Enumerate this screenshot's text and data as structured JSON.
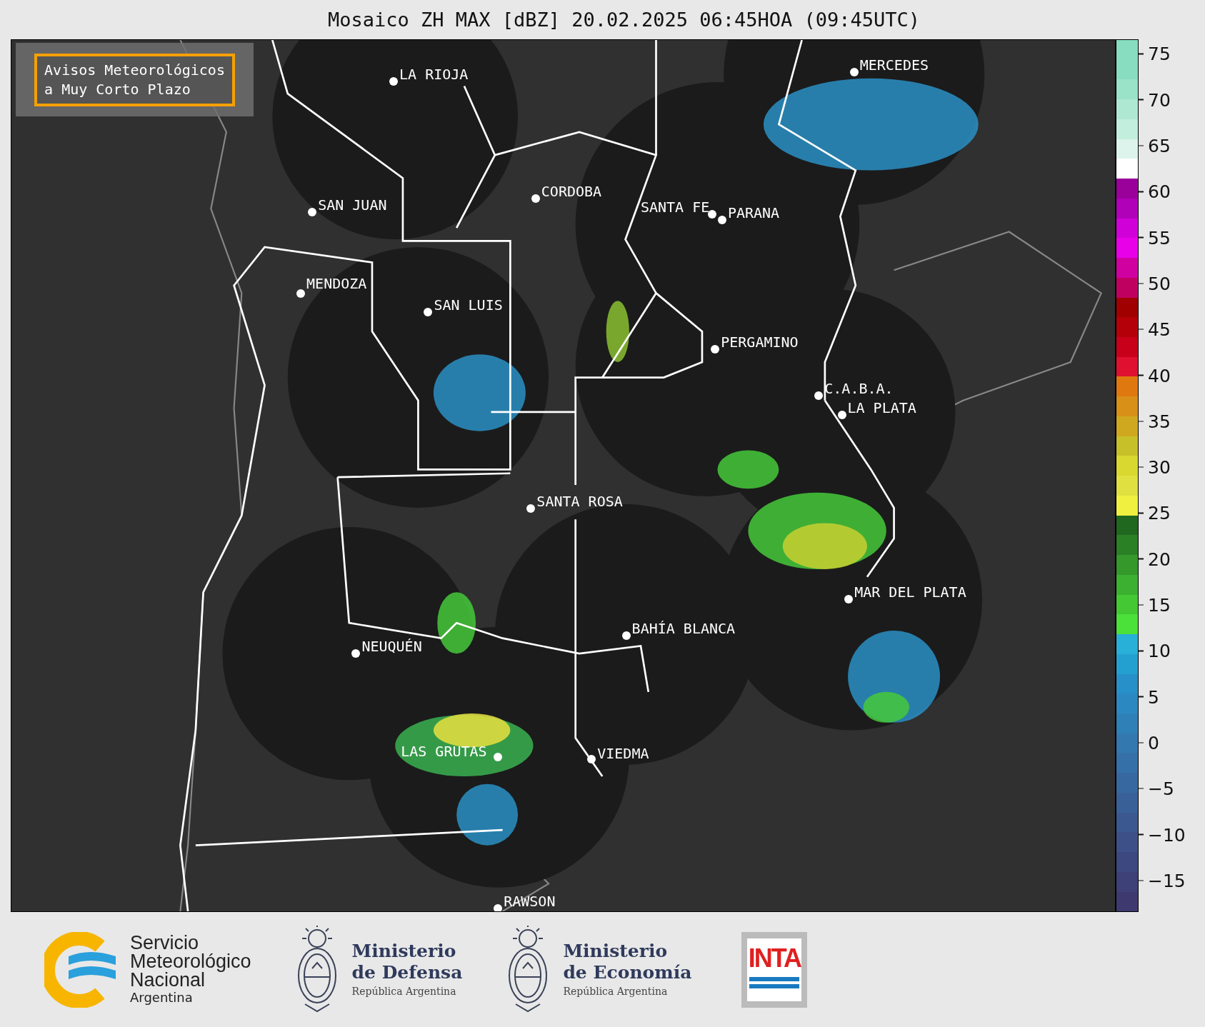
{
  "title": "Mosaico ZH MAX [dBZ] 20.02.2025 06:45HOA (09:45UTC)",
  "notice": {
    "lines": [
      "Avisos Meteorológicos",
      "a Muy Corto Plazo"
    ]
  },
  "cities": [
    {
      "name": "LA RIOJA"
    },
    {
      "name": "MERCEDES"
    },
    {
      "name": "CORDOBA"
    },
    {
      "name": "SAN JUAN"
    },
    {
      "name": "SANTA FE"
    },
    {
      "name": "PARANA"
    },
    {
      "name": "MENDOZA"
    },
    {
      "name": "SAN LUIS"
    },
    {
      "name": "PERGAMINO"
    },
    {
      "name": "C.A.B.A."
    },
    {
      "name": "LA PLATA"
    },
    {
      "name": "SANTA ROSA"
    },
    {
      "name": "MAR DEL PLATA"
    },
    {
      "name": "BAHÍA BLANCA"
    },
    {
      "name": "NEUQUÉN"
    },
    {
      "name": "LAS GRUTAS"
    },
    {
      "name": "VIEDMA"
    },
    {
      "name": "RAWSON"
    }
  ],
  "colorbar": {
    "ticks": [
      "75",
      "70",
      "65",
      "60",
      "55",
      "50",
      "45",
      "40",
      "35",
      "30",
      "25",
      "20",
      "15",
      "10",
      "5",
      "0",
      "−5",
      "−10",
      "−15"
    ]
  },
  "logos": [
    {
      "kind": "smn",
      "lines": [
        "Servicio",
        "Meteorológico",
        "Nacional"
      ],
      "subtitle": "Argentina"
    },
    {
      "kind": "crest",
      "lines": [
        "Ministerio",
        "de Defensa"
      ],
      "subtitle": "República Argentina"
    },
    {
      "kind": "crest",
      "lines": [
        "Ministerio",
        "de Economía"
      ],
      "subtitle": "República Argentina"
    },
    {
      "kind": "inta",
      "lines": [
        "INTA"
      ]
    }
  ]
}
